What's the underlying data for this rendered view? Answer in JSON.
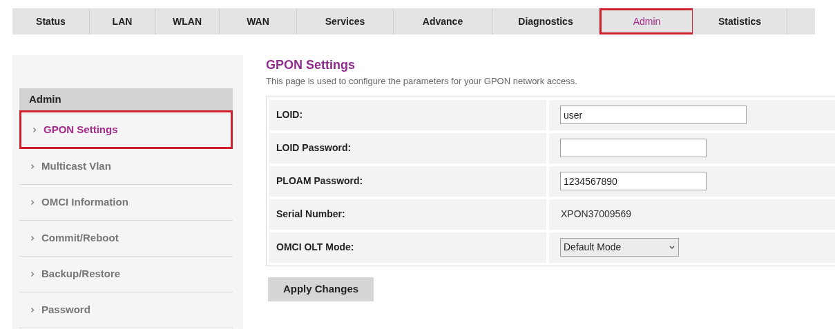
{
  "tabs": [
    {
      "label": "Status",
      "selected": false
    },
    {
      "label": "LAN",
      "selected": false
    },
    {
      "label": "WLAN",
      "selected": false
    },
    {
      "label": "WAN",
      "selected": false
    },
    {
      "label": "Services",
      "selected": false
    },
    {
      "label": "Advance",
      "selected": false
    },
    {
      "label": "Diagnostics",
      "selected": false
    },
    {
      "label": "Admin",
      "selected": true
    },
    {
      "label": "Statistics",
      "selected": false
    }
  ],
  "sidebar": {
    "title": "Admin",
    "items": [
      {
        "label": "GPON Settings",
        "selected": true
      },
      {
        "label": "Multicast Vlan",
        "selected": false
      },
      {
        "label": "OMCI Information",
        "selected": false
      },
      {
        "label": "Commit/Reboot",
        "selected": false
      },
      {
        "label": "Backup/Restore",
        "selected": false
      },
      {
        "label": "Password",
        "selected": false
      }
    ]
  },
  "page": {
    "title": "GPON Settings",
    "description": "This page is used to configure the parameters for your GPON network access."
  },
  "form": [
    {
      "kind": "input",
      "label": "LOID:",
      "value": "user",
      "wide": true
    },
    {
      "kind": "input",
      "label": "LOID Password:",
      "wide": false
    },
    {
      "kind": "input",
      "label": "PLOAM Password:",
      "value": "1234567890",
      "wide": false
    },
    {
      "kind": "static",
      "label": "Serial Number:",
      "value": "XPON37009569"
    },
    {
      "kind": "select",
      "label": "OMCI OLT Mode:",
      "value": "Default Mode"
    }
  ],
  "apply_button": "Apply Changes"
}
